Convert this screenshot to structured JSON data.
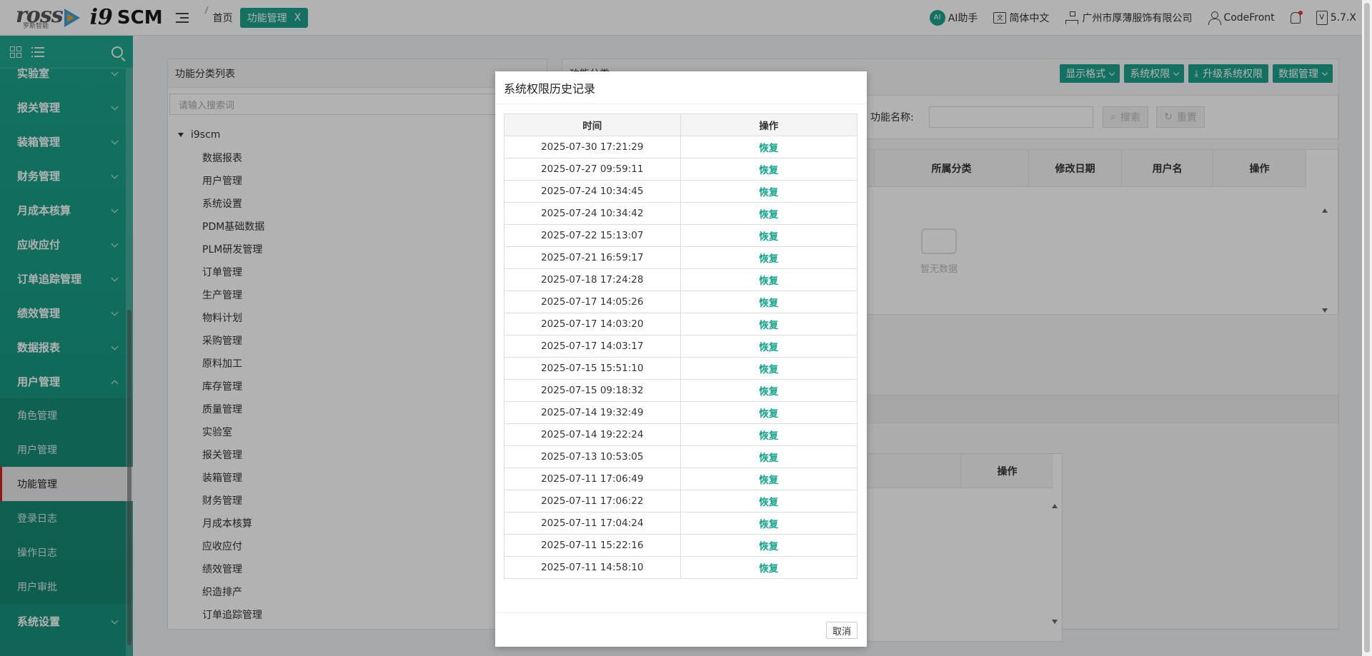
{
  "header": {
    "logo_brand": "ross",
    "logo_sub": "罗斯智能",
    "logo_product": "i9",
    "logo_suffix": "SCM",
    "home": "首页",
    "active_tab": "功能管理",
    "tab_close": "X",
    "ai_label": "AI助手",
    "ai_badge": "AI",
    "language": "简体中文",
    "lang_icon_text": "文",
    "company": "广州市厚薄服饰有限公司",
    "user": "CodeFront",
    "version": "5.7.X",
    "version_icon_text": "V"
  },
  "sidebar": {
    "items": [
      {
        "label": "实验室",
        "state": "collapsed"
      },
      {
        "label": "报关管理",
        "state": "collapsed"
      },
      {
        "label": "装箱管理",
        "state": "collapsed"
      },
      {
        "label": "财务管理",
        "state": "collapsed"
      },
      {
        "label": "月成本核算",
        "state": "collapsed"
      },
      {
        "label": "应收应付",
        "state": "collapsed"
      },
      {
        "label": "订单追踪管理",
        "state": "collapsed"
      },
      {
        "label": "绩效管理",
        "state": "collapsed"
      },
      {
        "label": "数据报表",
        "state": "collapsed"
      },
      {
        "label": "用户管理",
        "state": "expanded"
      }
    ],
    "sub_items": [
      {
        "label": "角色管理",
        "active": false
      },
      {
        "label": "用户管理",
        "active": false
      },
      {
        "label": "功能管理",
        "active": true
      },
      {
        "label": "登录日志",
        "active": false
      },
      {
        "label": "操作日志",
        "active": false
      },
      {
        "label": "用户审批",
        "active": false
      }
    ],
    "last_item": {
      "label": "系统设置"
    }
  },
  "left_panel": {
    "title": "功能分类列表",
    "search_placeholder": "请输入搜索词",
    "root": "i9scm",
    "nodes": [
      "数据报表",
      "用户管理",
      "系统设置",
      "PDM基础数据",
      "PLM研发管理",
      "订单管理",
      "生产管理",
      "物料计划",
      "采购管理",
      "原料加工",
      "库存管理",
      "质量管理",
      "实验室",
      "报关管理",
      "装箱管理",
      "财务管理",
      "月成本核算",
      "应收应付",
      "绩效管理",
      "织造排产",
      "订单追踪管理"
    ]
  },
  "right_panel": {
    "title_partial": "功能分类",
    "buttons": [
      "显示格式",
      "系统权限",
      "升级系统权限",
      "数据管理"
    ],
    "filter_label": "功能名称:",
    "search_btn": "搜索",
    "reset_btn": "重置",
    "columns": [
      "所属分类",
      "修改日期",
      "用户名",
      "操作"
    ],
    "empty_text": "暂无数据",
    "sub_column": "操作"
  },
  "modal": {
    "title": "系统权限历史记录",
    "columns": [
      "时间",
      "操作"
    ],
    "rows": [
      {
        "time": "2025-07-30 17:21:29",
        "action": "恢复"
      },
      {
        "time": "2025-07-27 09:59:11",
        "action": "恢复"
      },
      {
        "time": "2025-07-24 10:34:45",
        "action": "恢复"
      },
      {
        "time": "2025-07-24 10:34:42",
        "action": "恢复"
      },
      {
        "time": "2025-07-22 15:13:07",
        "action": "恢复"
      },
      {
        "time": "2025-07-21 16:59:17",
        "action": "恢复"
      },
      {
        "time": "2025-07-18 17:24:28",
        "action": "恢复"
      },
      {
        "time": "2025-07-17 14:05:26",
        "action": "恢复"
      },
      {
        "time": "2025-07-17 14:03:20",
        "action": "恢复"
      },
      {
        "time": "2025-07-17 14:03:17",
        "action": "恢复"
      },
      {
        "time": "2025-07-15 15:51:10",
        "action": "恢复"
      },
      {
        "time": "2025-07-15 09:18:32",
        "action": "恢复"
      },
      {
        "time": "2025-07-14 19:32:49",
        "action": "恢复"
      },
      {
        "time": "2025-07-14 19:22:24",
        "action": "恢复"
      },
      {
        "time": "2025-07-13 10:53:05",
        "action": "恢复"
      },
      {
        "time": "2025-07-11 17:06:49",
        "action": "恢复"
      },
      {
        "time": "2025-07-11 17:06:22",
        "action": "恢复"
      },
      {
        "time": "2025-07-11 17:04:24",
        "action": "恢复"
      },
      {
        "time": "2025-07-11 15:22:16",
        "action": "恢复"
      },
      {
        "time": "2025-07-11 14:58:10",
        "action": "恢复"
      }
    ],
    "cancel": "取消"
  },
  "colors": {
    "accent": "#1aa38a",
    "link": "#14a58c",
    "active_marker": "#d42222"
  }
}
